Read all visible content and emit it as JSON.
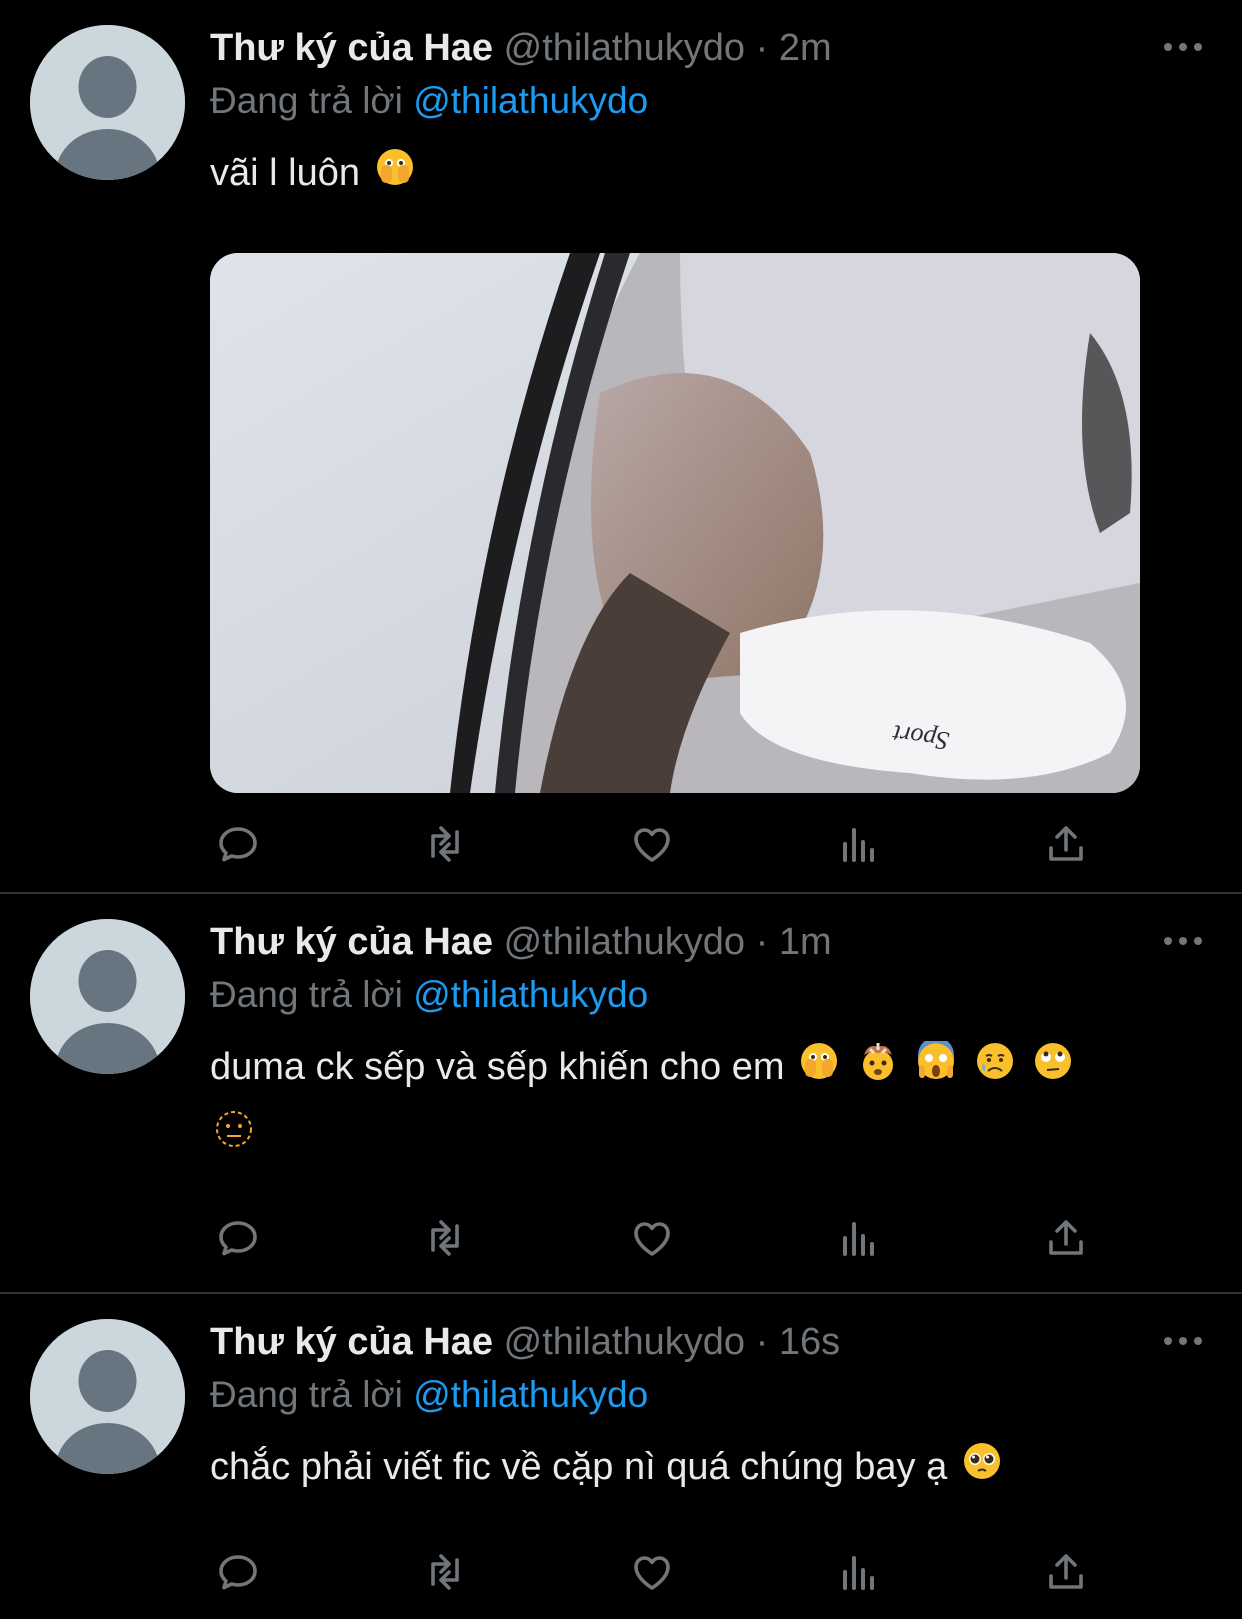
{
  "tweets": [
    {
      "name": "Thư ký của Hae",
      "handle": "@thilathukydo",
      "time": "2m",
      "replying_prefix": "Đang trả lời",
      "replying_to": "@thilathukydo",
      "text": "vãi l luôn",
      "emojis": [
        "face-with-open-eyes-and-hand-over-mouth"
      ],
      "media": {
        "type": "photo",
        "sock_text": "Sport"
      }
    },
    {
      "name": "Thư ký của Hae",
      "handle": "@thilathukydo",
      "time": "1m",
      "replying_prefix": "Đang trả lời",
      "replying_to": "@thilathukydo",
      "text": "duma ck sếp và sếp khiến cho em",
      "emojis": [
        "face-with-open-eyes-and-hand-over-mouth",
        "exploding-head",
        "screaming-face",
        "sad-but-relieved-face",
        "rolling-eyes-face",
        "dotted-line-face"
      ]
    },
    {
      "name": "Thư ký của Hae",
      "handle": "@thilathukydo",
      "time": "16s",
      "replying_prefix": "Đang trả lời",
      "replying_to": "@thilathukydo",
      "text": "chắc phải viết fic về cặp nì quá chúng bay ạ",
      "emojis": [
        "pleading-face"
      ]
    }
  ],
  "actions": [
    "reply-icon",
    "retweet-icon",
    "like-icon",
    "analytics-icon",
    "share-icon"
  ],
  "colors": {
    "background": "#000000",
    "text": "#e7e9ea",
    "secondary": "#71767b",
    "accent": "#1d9bf0",
    "divider": "#2f3336",
    "avatar": "#ccd6dd"
  }
}
